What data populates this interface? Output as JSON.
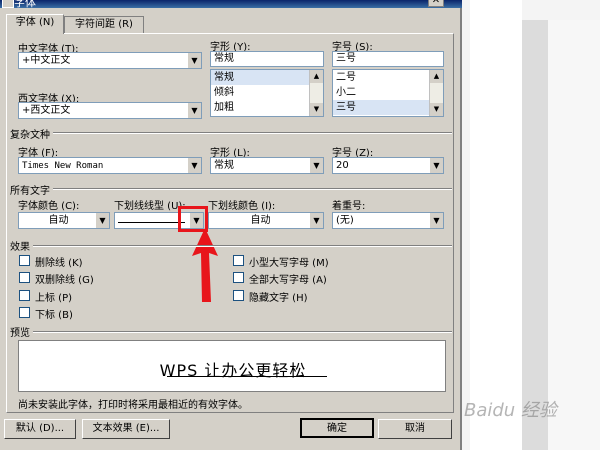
{
  "window": {
    "title": "字体",
    "close_label": "✕"
  },
  "tabs": [
    {
      "label": "字体 (N)"
    },
    {
      "label": "字符间距 (R)"
    }
  ],
  "chinese_font": {
    "label": "中文字体 (T):",
    "value": "+中文正文"
  },
  "western_font": {
    "label": "西文字体 (X):",
    "value": "+西文正文"
  },
  "style": {
    "label": "字形 (Y):",
    "value": "常规",
    "options": [
      "常规",
      "倾斜",
      "加粗"
    ],
    "selected": 0
  },
  "size": {
    "label": "字号 (S):",
    "value": "三号",
    "options": [
      "二号",
      "小二",
      "三号"
    ],
    "selected": 2
  },
  "complex": {
    "title": "复杂文种",
    "font_label": "字体 (F):",
    "font_value": "Times New Roman",
    "style_label": "字形 (L):",
    "style_value": "常规",
    "size_label": "字号 (Z):",
    "size_value": "20"
  },
  "all_text": {
    "title": "所有文字",
    "color_label": "字体颜色 (C):",
    "color_value": "自动",
    "underline_type_label": "下划线线型 (U):",
    "underline_type_value": "",
    "underline_color_label": "下划线颜色 (I):",
    "underline_color_value": "自动",
    "emphasis_label": "着重号:",
    "emphasis_value": "(无)"
  },
  "effects": {
    "title": "效果",
    "left": [
      "删除线 (K)",
      "双删除线 (G)",
      "上标 (P)",
      "下标 (B)"
    ],
    "right": [
      "小型大写字母 (M)",
      "全部大写字母 (A)",
      "隐藏文字 (H)"
    ]
  },
  "preview": {
    "title": "预览",
    "text": "WPS 让办公更轻松",
    "note": "尚未安装此字体，打印时将采用最相近的有效字体。"
  },
  "buttons": {
    "default": "默认 (D)...",
    "text_effects": "文本效果 (E)...",
    "ok": "确定",
    "cancel": "取消"
  },
  "watermark": "Baidu 经验",
  "colors": {
    "highlight_box": "#e8151b",
    "arrow": "#e8151b"
  }
}
